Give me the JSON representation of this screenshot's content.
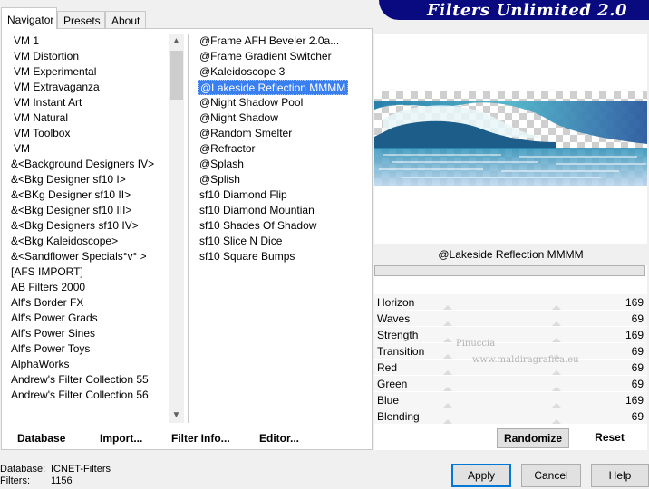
{
  "window": {
    "title": "Filters Unlimited 2.0"
  },
  "tabs": [
    {
      "label": "Navigator",
      "active": true
    },
    {
      "label": "Presets",
      "active": false
    },
    {
      "label": "About",
      "active": false
    }
  ],
  "categories": [
    "VM 1",
    "VM Distortion",
    "VM Experimental",
    "VM Extravaganza",
    "VM Instant Art",
    "VM Natural",
    "VM Toolbox",
    "VM",
    "&<Background Designers IV>",
    "&<Bkg Designer sf10 I>",
    "&<BKg Designer sf10 II>",
    "&<Bkg Designer sf10 III>",
    "&<Bkg Designers sf10 IV>",
    "&<Bkg Kaleidoscope>",
    "&<Sandflower Specials°v° >",
    "[AFS IMPORT]",
    "AB Filters 2000",
    "Alf's Border FX",
    "Alf's Power Grads",
    "Alf's Power Sines",
    "Alf's Power Toys",
    "AlphaWorks",
    "Andrew's Filter Collection 55",
    "Andrew's Filter Collection 56"
  ],
  "filters": {
    "items": [
      "@Frame AFH Beveler 2.0a...",
      "@Frame Gradient Switcher",
      "@Kaleidoscope 3",
      "@Lakeside Reflection MMMM",
      "@Night Shadow Pool",
      "@Night Shadow",
      "@Random Smelter",
      "@Refractor",
      "@Splash",
      "@Splish",
      "sf10 Diamond Flip",
      "sf10 Diamond Mountian",
      "sf10 Shades Of Shadow",
      "sf10 Slice N Dice",
      "sf10 Square Bumps"
    ],
    "selected_index": 3
  },
  "left_buttons": {
    "database": "Database",
    "import": "Import...",
    "filter_info": "Filter Info...",
    "editor": "Editor..."
  },
  "current_filter": "@Lakeside Reflection MMMM",
  "params": [
    {
      "name": "Horizon",
      "value": "169"
    },
    {
      "name": "Waves",
      "value": "69"
    },
    {
      "name": "Strength",
      "value": "169"
    },
    {
      "name": "Transition",
      "value": "69"
    },
    {
      "name": "Red",
      "value": "69"
    },
    {
      "name": "Green",
      "value": "69"
    },
    {
      "name": "Blue",
      "value": "169"
    },
    {
      "name": "Blending",
      "value": "69"
    }
  ],
  "right_buttons": {
    "randomize": "Randomize",
    "reset": "Reset"
  },
  "status": {
    "database_label": "Database:",
    "database_value": "ICNET-Filters",
    "filters_label": "Filters:",
    "filters_value": "1156"
  },
  "dialog_buttons": {
    "apply": "Apply",
    "cancel": "Cancel",
    "help": "Help"
  },
  "watermark": {
    "line1": "Pinuccia",
    "line2": "www.maldiragrafica.eu"
  },
  "colors": {
    "banner": "#0a0a80",
    "selection": "#3a7ff0",
    "default_button_border": "#0078d7"
  }
}
